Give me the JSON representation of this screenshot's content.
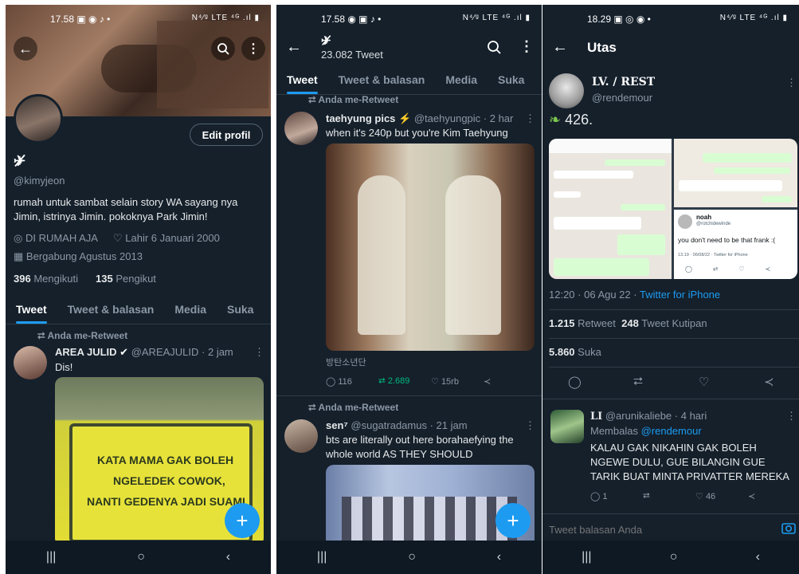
{
  "screens": [
    {
      "status": {
        "time": "17.58 ▣ ◉ ♪ •",
        "right": "N⁴⁄ᵍ LTE ⁴ᴳ .ıl ▮"
      },
      "profile": {
        "name_symbol": "✈̸",
        "handle": "@kimyjeon",
        "edit_button": "Edit profil",
        "bio": [
          "rumah untuk sambat selain story WA  sayang nya",
          "Jimin, istrinya Jimin. pokoknya Park Jimin!"
        ],
        "location": "DI RUMAH AJA",
        "birth": "Lahir 6 Januari 2000",
        "joined": "Bergabung Agustus 2013",
        "following_count": "396",
        "following_label": "Mengikuti",
        "followers_count": "135",
        "followers_label": "Pengikut"
      },
      "tabs": [
        "Tweet",
        "Tweet & balasan",
        "Media",
        "Suka"
      ],
      "retweet_label": "Anda me-Retweet",
      "tweet": {
        "author": "AREA JULID",
        "handle": "@AREAJULID",
        "time": "· 2 jam",
        "text": "Dis!",
        "sign_lines": [
          "KATA MAMA GAK BOLEH",
          "NGELEDEK COWOK,",
          "NANTI GEDENYA JADI SUAMI"
        ]
      }
    },
    {
      "status": {
        "time": "17.58 ◉ ▣ ♪ •",
        "right": "N⁴⁄ᵍ LTE ⁴ᴳ .ıl ▮"
      },
      "header": {
        "name_symbol": "✈̸",
        "count": "23.082 Tweet"
      },
      "tabs": [
        "Tweet",
        "Tweet & balasan",
        "Media",
        "Suka"
      ],
      "tweet1": {
        "retweet_label": "Anda me-Retweet",
        "author": "taehyung pics",
        "handle": "@taehyungpic",
        "time": "· 2 har",
        "text": "when it's 240p but you're Kim Taehyung",
        "caption": "방탄소년단",
        "replies": "116",
        "retweets": "2.689",
        "likes": "15rb"
      },
      "tweet2": {
        "retweet_label": "Anda me-Retweet",
        "author": "sen⁷",
        "handle": "@sugatradamus",
        "time": "· 21 jam",
        "text": [
          "bts are literally out here borahaefying the",
          "whole world AS THEY SHOULD"
        ]
      }
    },
    {
      "status": {
        "time": "18.29 ▣ ◎ ◉ •",
        "right": "N⁴⁄ᵍ LTE ⁴ᴳ .ıl ▮"
      },
      "header": {
        "title": "Utas"
      },
      "tweet": {
        "author": "LV. / REST",
        "handle": "@rendemour",
        "text": "426.",
        "timestamp": "12:20 · 06 Agu 22 ·",
        "source": "Twitter for iPhone",
        "retweets_count": "1.215",
        "retweets_label": "Retweet",
        "quotes_count": "248",
        "quotes_label": "Tweet Kutipan",
        "likes_count": "5.860",
        "likes_label": "Suka"
      },
      "embedded_tweet": {
        "name": "noah",
        "handle": "@rotchidewinde",
        "text": "you don't need to be that frank :(",
        "meta": "13.19 · 06/08/22 · Twitter for iPhone"
      },
      "reply": {
        "author": "LI",
        "handle": "@arunikaliebe",
        "time": "· 4 hari",
        "replying_label": "Membalas",
        "replying_to": "@rendemour",
        "text": [
          "KALAU GAK NIKAHIN GAK BOLEH",
          "NGEWE DULU, GUE BILANGIN GUE",
          "TARIK BUAT MINTA PRIVATTER MEREKA"
        ],
        "replies": "1",
        "likes": "46"
      },
      "reply_box": {
        "placeholder": "Tweet balasan Anda"
      }
    }
  ],
  "colors": {
    "background": "#15202b",
    "accent": "#1d9bf0",
    "retweet_green": "#00ba7c"
  }
}
